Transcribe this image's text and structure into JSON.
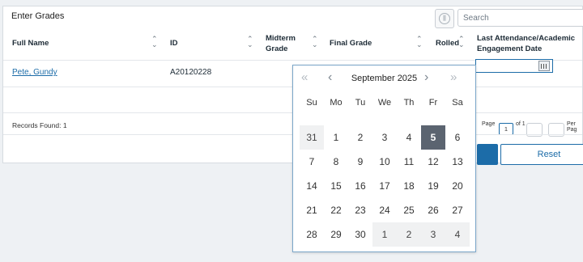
{
  "panel": {
    "title": "Enter Grades",
    "search_placeholder": "Search"
  },
  "table": {
    "columns": [
      "Full Name",
      "ID",
      "Midterm Grade",
      "Final Grade",
      "Rolled",
      "Last Attendance/Academic Engagement Date"
    ],
    "rows": [
      {
        "full_name": "Pete, Gundy",
        "id": "A20120228"
      }
    ]
  },
  "footer": {
    "records_found": "Records Found: 1",
    "page_label": "Page",
    "page_value": "1",
    "of_label": "of 1",
    "per_page_label": "Per Pag",
    "reset_label": "Reset"
  },
  "calendar": {
    "month_label": "September 2025",
    "weekdays": [
      "Su",
      "Mo",
      "Tu",
      "We",
      "Th",
      "Fr",
      "Sa"
    ],
    "weeks": [
      [
        "31",
        "1",
        "2",
        "3",
        "4",
        "5",
        "6"
      ],
      [
        "7",
        "8",
        "9",
        "10",
        "11",
        "12",
        "13"
      ],
      [
        "14",
        "15",
        "16",
        "17",
        "18",
        "19",
        "20"
      ],
      [
        "21",
        "22",
        "23",
        "24",
        "25",
        "26",
        "27"
      ],
      [
        "28",
        "29",
        "30",
        "1",
        "2",
        "3",
        "4"
      ]
    ],
    "selected": "5",
    "icons": {
      "prev_year": "double-chevron-left-icon",
      "prev_month": "chevron-left-icon",
      "next_month": "chevron-right-icon",
      "next_year": "double-chevron-right-icon"
    }
  },
  "colors": {
    "accent": "#1c6ca8",
    "selected_day": "#5b6470",
    "other_month_day": "#f0f1f2"
  }
}
